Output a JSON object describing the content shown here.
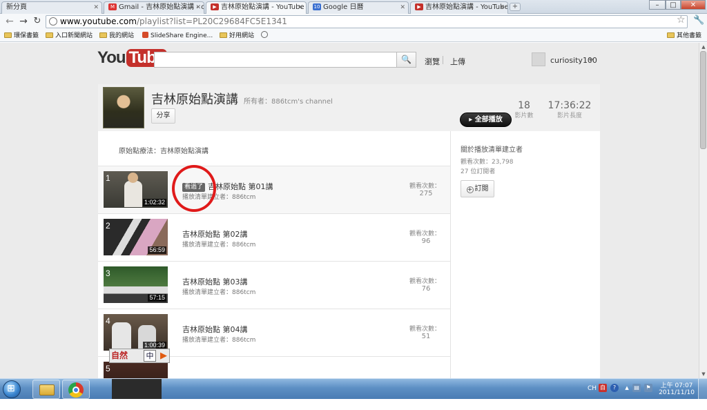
{
  "browser": {
    "tabs": [
      {
        "label": "新分頁",
        "icon": "blank-page-icon",
        "active": false
      },
      {
        "label": "Gmail - 吉林原始點演講 - c",
        "icon": "gmail-icon",
        "active": false
      },
      {
        "label": "吉林原始點演講 - YouTube",
        "icon": "youtube-icon",
        "active": true
      },
      {
        "label": "Google 日曆",
        "icon": "calendar-icon",
        "active": false
      },
      {
        "label": "吉林原始點演講 - YouTube",
        "icon": "youtube-icon",
        "active": false
      }
    ],
    "url_host": "www.youtube.com",
    "url_path": "/playlist?list=PL20C29684FC5E1341",
    "bookmarks": [
      {
        "label": "環保書籤",
        "icon": "folder-icon"
      },
      {
        "label": "入口新聞網站",
        "icon": "folder-icon"
      },
      {
        "label": "我的網站",
        "icon": "folder-icon"
      },
      {
        "label": "SlideShare Engine...",
        "icon": "slideshare-icon"
      },
      {
        "label": "好用網站",
        "icon": "folder-icon"
      }
    ],
    "other_bookmarks": "其他書籤"
  },
  "youtube": {
    "logo_you": "You",
    "logo_tube": "Tube",
    "browse_label": "瀏覽",
    "upload_label": "上傳",
    "username": "curiosity100"
  },
  "playlist": {
    "title": "吉林原始點演講",
    "owner": "所有者：886tcm's channel",
    "share_label": "分享",
    "play_all_label": "全部播放",
    "video_count": "18",
    "video_count_label": "影片數",
    "total_length": "17:36:22",
    "total_length_label": "影片長度",
    "description": "原始點療法：吉林原始點演講",
    "videos": [
      {
        "index": "1",
        "title": "吉林原始點 第01講",
        "author": "播放清單建立者：886tcm",
        "duration": "1:02:32",
        "views_label": "觀看次數：",
        "views": "275",
        "watched": true,
        "watched_label": "看過了"
      },
      {
        "index": "2",
        "title": "吉林原始點 第02講",
        "author": "播放清單建立者：886tcm",
        "duration": "56:59",
        "views_label": "觀看次數：",
        "views": "96",
        "watched": false
      },
      {
        "index": "3",
        "title": "吉林原始點 第03講",
        "author": "播放清單建立者：886tcm",
        "duration": "57:15",
        "views_label": "觀看次數：",
        "views": "76",
        "watched": false
      },
      {
        "index": "4",
        "title": "吉林原始點 第04講",
        "author": "播放清單建立者：886tcm",
        "duration": "1:00:39",
        "views_label": "觀看次數：",
        "views": "51",
        "watched": false
      },
      {
        "index": "5",
        "title": "",
        "author": "",
        "duration": "",
        "views_label": "",
        "views": "",
        "watched": false
      }
    ]
  },
  "sidebar": {
    "title": "關於播放清單建立者",
    "views": "觀看次數：23,798",
    "subscribers": "27 位訂閱者",
    "subscribe_label": "訂閱"
  },
  "ime": {
    "logo": "自然",
    "lang": "中"
  },
  "taskbar": {
    "lang": "CH",
    "time": "上午 07:07",
    "date": "2011/11/10"
  },
  "colors": {
    "youtube_red": "#c4302b",
    "annotation_circle": "#e01a1a"
  }
}
